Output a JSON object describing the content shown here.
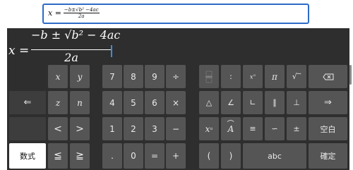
{
  "input": {
    "lhs": "x =",
    "numerator": "−b±√b² −4ac",
    "denominator": "2a"
  },
  "display": {
    "lhs": "x =",
    "numerator": "−b ± √b² − 4ac",
    "denominator": "2a"
  },
  "keys": {
    "x": "x",
    "y": "y",
    "z": "z",
    "n": "n",
    "left_arrow": "<",
    "right_arrow": ">",
    "le": "≦",
    "ge": "≧",
    "d7": "7",
    "d8": "8",
    "d9": "9",
    "div": "÷",
    "d4": "4",
    "d5": "5",
    "d6": "6",
    "mul": "×",
    "d1": "1",
    "d2": "2",
    "d3": "3",
    "minus": "−",
    "dot": ".",
    "d0": "0",
    "eq": "=",
    "plus": "+",
    "colon": ":",
    "pi": "π",
    "sqrt": "√‾",
    "triangle": "△",
    "angle": "∠",
    "perp_l": "∟",
    "parallel": "∥",
    "perp": "⊥",
    "xpow": "x",
    "arc": "A",
    "congruent": "≡",
    "similar": "∽",
    "pm": "±",
    "lparen": "(",
    "rparen": ")",
    "abc": "abc",
    "space": "空白",
    "enter": "確定",
    "mode": "数式"
  }
}
